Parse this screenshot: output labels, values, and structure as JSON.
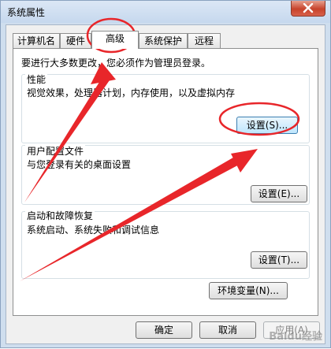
{
  "window": {
    "title": "系统属性"
  },
  "tabs": [
    "计算机名",
    "硬件",
    "高级",
    "系统保护",
    "远程"
  ],
  "intro": "要进行大多数更改，您必须作为管理员登录。",
  "performance": {
    "title": "性能",
    "desc": "视觉效果，处理器计划，内存使用，以及虚拟内存",
    "button": "设置(S)..."
  },
  "profile": {
    "title": "用户配置文件",
    "desc": "与您登录有关的桌面设置",
    "button": "设置(E)..."
  },
  "startup": {
    "title": "启动和故障恢复",
    "desc": "系统启动、系统失败和调试信息",
    "button": "设置(T)..."
  },
  "env_button": "环境变量(N)...",
  "footer": {
    "ok": "确定",
    "cancel": "取消",
    "apply": "应用(A)"
  },
  "watermark": "Baidu经验",
  "colors": {
    "annotation": "#e8262a",
    "accent": "#3c7fb1"
  }
}
